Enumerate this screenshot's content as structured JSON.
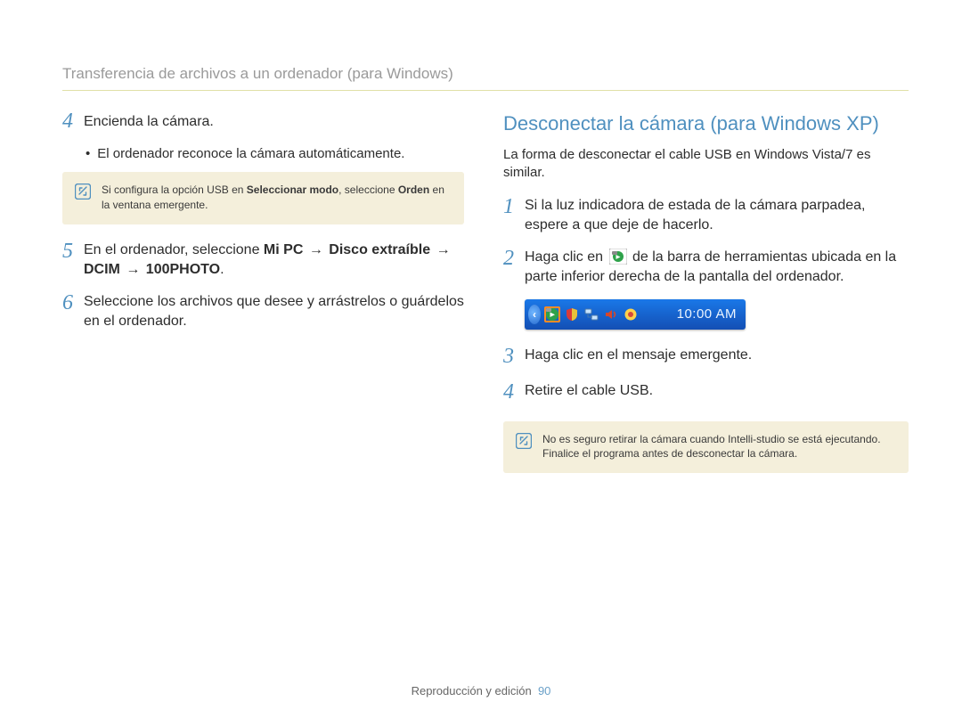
{
  "header": {
    "title": "Transferencia de archivos a un ordenador (para Windows)"
  },
  "left": {
    "step4": {
      "num": "4",
      "text": "Encienda la cámara.",
      "bullet": "El ordenador reconoce la cámara automáticamente."
    },
    "note1": {
      "prefix": "Si configura la opción USB en ",
      "bold1": "Seleccionar modo",
      "mid": ", seleccione ",
      "bold2": "Orden",
      "suffix": " en la ventana emergente."
    },
    "step5": {
      "num": "5",
      "pre": "En el ordenador, seleccione ",
      "b1": "Mi PC",
      "arrow": "→",
      "b2": "Disco extraíble",
      "b3": "DCIM",
      "b4": "100PHOTO",
      "period": "."
    },
    "step6": {
      "num": "6",
      "text": "Seleccione los archivos que desee y arrástrelos o guárdelos en el ordenador."
    }
  },
  "right": {
    "title": "Desconectar la cámara (para Windows XP)",
    "intro": "La forma de desconectar el cable USB en Windows Vista/7 es similar.",
    "step1": {
      "num": "1",
      "text": "Si la luz indicadora de estada de la cámara parpadea, espere a que deje de hacerlo."
    },
    "step2": {
      "num": "2",
      "pre": "Haga clic en ",
      "post": " de la barra de herramientas ubicada en la parte inferior derecha de la pantalla del ordenador."
    },
    "systray": {
      "time": "10:00 AM"
    },
    "step3": {
      "num": "3",
      "text": "Haga clic en el mensaje emergente."
    },
    "step4": {
      "num": "4",
      "text": "Retire el cable USB."
    },
    "note2": {
      "line1": "No es seguro retirar la cámara cuando Intelli-studio se está ejecutando.",
      "line2": "Finalice el programa antes de desconectar la cámara."
    }
  },
  "footer": {
    "section": "Reproducción y edición",
    "page": "90"
  }
}
